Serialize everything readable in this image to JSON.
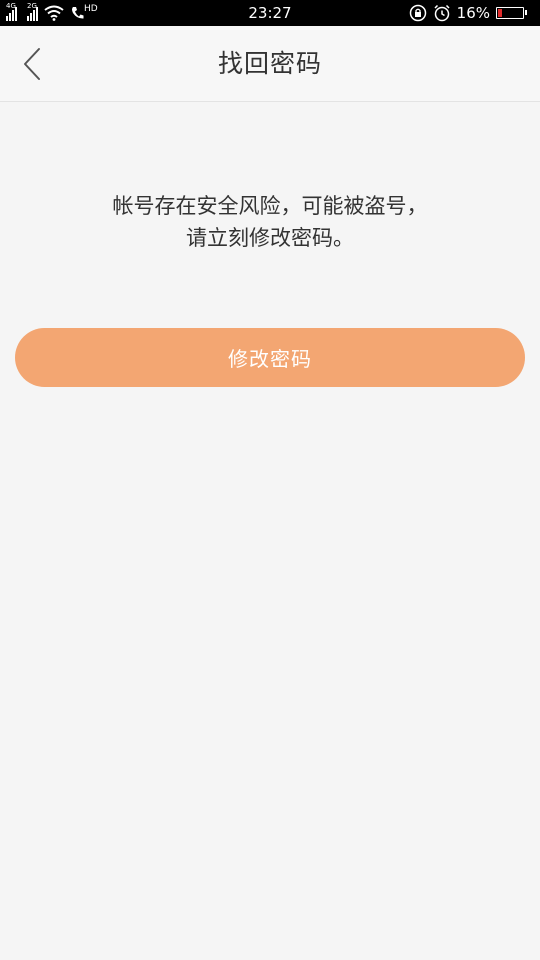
{
  "status_bar": {
    "time": "23:27",
    "signal_1_label": "4G",
    "signal_2_label": "2G",
    "network_type": "HD",
    "battery_text": "16%",
    "battery_level": 0.16,
    "battery_color": "#e12c2c",
    "icons": [
      "signal-icon",
      "signal-icon",
      "wifi-icon",
      "phone-hd-icon",
      "rotation-lock-icon",
      "alarm-icon",
      "battery-icon"
    ]
  },
  "nav": {
    "back_icon": "chevron-left-icon",
    "title": "找回密码"
  },
  "main": {
    "message_line1": "帐号存在安全风险，可能被盗号，",
    "message_line2": "请立刻修改密码。",
    "change_password_button": "修改密码"
  },
  "colors": {
    "background": "#f5f5f5",
    "accent": "#f3a672",
    "text": "#333333"
  }
}
